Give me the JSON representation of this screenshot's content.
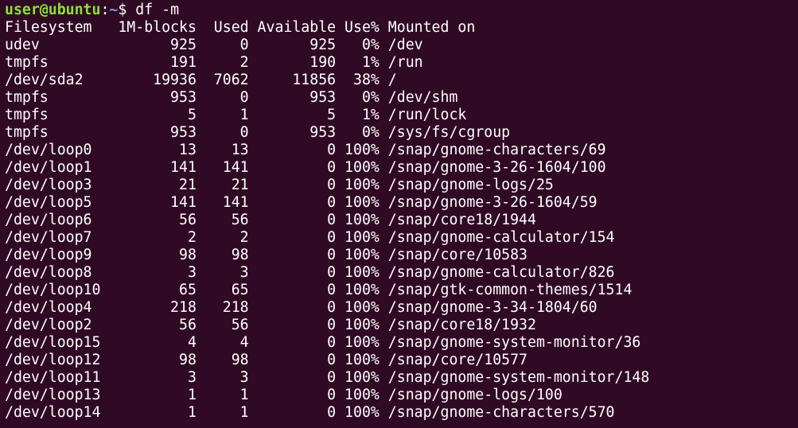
{
  "prompt": {
    "user_host": "user@ubuntu",
    "separator": ":",
    "path": "~",
    "symbol": "$",
    "command": "df -m"
  },
  "colors": {
    "background": "#300a24",
    "text": "#ffffff",
    "prompt_user": "#8ae234",
    "prompt_path": "#729fcf"
  },
  "table": {
    "headers": [
      "Filesystem",
      "1M-blocks",
      "Used",
      "Available",
      "Use%",
      "Mounted on"
    ],
    "rows": [
      [
        "udev",
        "925",
        "0",
        "925",
        "0%",
        "/dev"
      ],
      [
        "tmpfs",
        "191",
        "2",
        "190",
        "1%",
        "/run"
      ],
      [
        "/dev/sda2",
        "19936",
        "7062",
        "11856",
        "38%",
        "/"
      ],
      [
        "tmpfs",
        "953",
        "0",
        "953",
        "0%",
        "/dev/shm"
      ],
      [
        "tmpfs",
        "5",
        "1",
        "5",
        "1%",
        "/run/lock"
      ],
      [
        "tmpfs",
        "953",
        "0",
        "953",
        "0%",
        "/sys/fs/cgroup"
      ],
      [
        "/dev/loop0",
        "13",
        "13",
        "0",
        "100%",
        "/snap/gnome-characters/69"
      ],
      [
        "/dev/loop1",
        "141",
        "141",
        "0",
        "100%",
        "/snap/gnome-3-26-1604/100"
      ],
      [
        "/dev/loop3",
        "21",
        "21",
        "0",
        "100%",
        "/snap/gnome-logs/25"
      ],
      [
        "/dev/loop5",
        "141",
        "141",
        "0",
        "100%",
        "/snap/gnome-3-26-1604/59"
      ],
      [
        "/dev/loop6",
        "56",
        "56",
        "0",
        "100%",
        "/snap/core18/1944"
      ],
      [
        "/dev/loop7",
        "2",
        "2",
        "0",
        "100%",
        "/snap/gnome-calculator/154"
      ],
      [
        "/dev/loop9",
        "98",
        "98",
        "0",
        "100%",
        "/snap/core/10583"
      ],
      [
        "/dev/loop8",
        "3",
        "3",
        "0",
        "100%",
        "/snap/gnome-calculator/826"
      ],
      [
        "/dev/loop10",
        "65",
        "65",
        "0",
        "100%",
        "/snap/gtk-common-themes/1514"
      ],
      [
        "/dev/loop4",
        "218",
        "218",
        "0",
        "100%",
        "/snap/gnome-3-34-1804/60"
      ],
      [
        "/dev/loop2",
        "56",
        "56",
        "0",
        "100%",
        "/snap/core18/1932"
      ],
      [
        "/dev/loop15",
        "4",
        "4",
        "0",
        "100%",
        "/snap/gnome-system-monitor/36"
      ],
      [
        "/dev/loop12",
        "98",
        "98",
        "0",
        "100%",
        "/snap/core/10577"
      ],
      [
        "/dev/loop11",
        "3",
        "3",
        "0",
        "100%",
        "/snap/gnome-system-monitor/148"
      ],
      [
        "/dev/loop13",
        "1",
        "1",
        "0",
        "100%",
        "/snap/gnome-logs/100"
      ],
      [
        "/dev/loop14",
        "1",
        "1",
        "0",
        "100%",
        "/snap/gnome-characters/570"
      ]
    ]
  }
}
